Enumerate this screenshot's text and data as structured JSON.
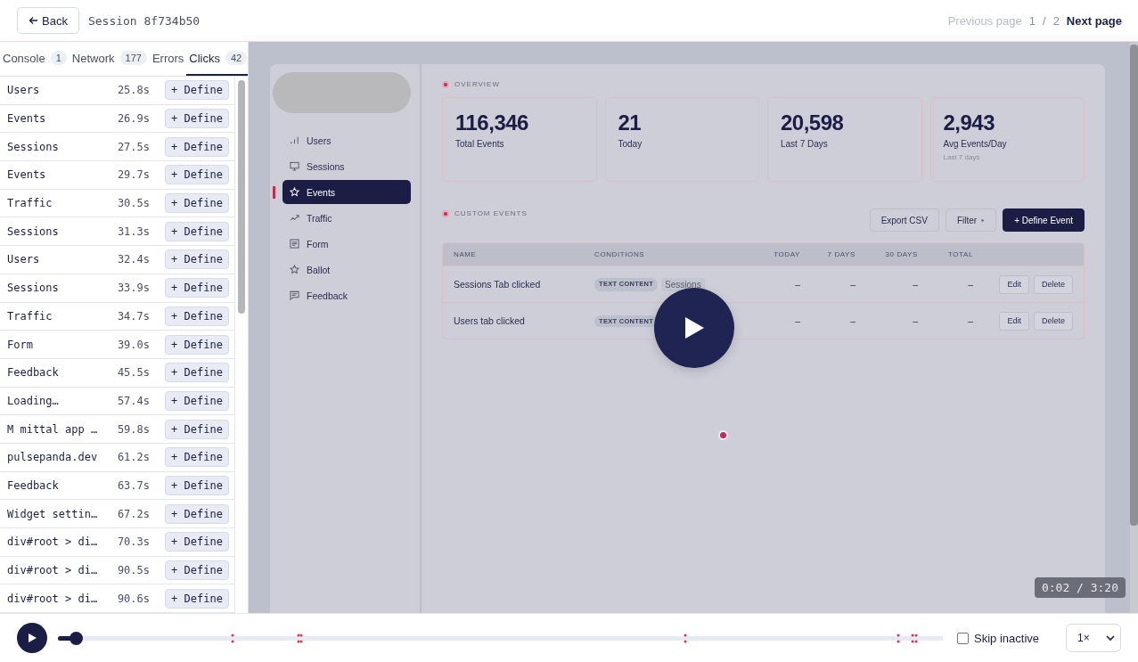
{
  "header": {
    "back_button": "Back",
    "session_title": "Session 8f734b50",
    "pagination": {
      "previous": {
        "label": "Previous page",
        "disabled": true
      },
      "current": "1",
      "separator": "/",
      "total": "2",
      "next": {
        "label": "Next page",
        "disabled": false
      }
    }
  },
  "tabs": [
    {
      "label": "Console",
      "count": "1",
      "selected": false
    },
    {
      "label": "Network",
      "count": "177",
      "selected": false
    },
    {
      "label": "Errors",
      "selected": false
    },
    {
      "label": "Clicks",
      "count": "42",
      "selected": true
    }
  ],
  "clicks": [
    {
      "label": "Users",
      "time": "25.8s",
      "action": "+ Define"
    },
    {
      "label": "Events",
      "time": "26.9s",
      "action": "+ Define"
    },
    {
      "label": "Sessions",
      "time": "27.5s",
      "action": "+ Define"
    },
    {
      "label": "Events",
      "time": "29.7s",
      "action": "+ Define"
    },
    {
      "label": "Traffic",
      "time": "30.5s",
      "action": "+ Define"
    },
    {
      "label": "Sessions",
      "time": "31.3s",
      "action": "+ Define"
    },
    {
      "label": "Users",
      "time": "32.4s",
      "action": "+ Define"
    },
    {
      "label": "Sessions",
      "time": "33.9s",
      "action": "+ Define"
    },
    {
      "label": "Traffic",
      "time": "34.7s",
      "action": "+ Define"
    },
    {
      "label": "Form",
      "time": "39.0s",
      "action": "+ Define"
    },
    {
      "label": "Feedback",
      "time": "45.5s",
      "action": "+ Define"
    },
    {
      "label": "Loading…",
      "time": "57.4s",
      "action": "+ Define"
    },
    {
      "label": "M mittal app …",
      "time": "59.8s",
      "action": "+ Define"
    },
    {
      "label": "pulsepanda.dev",
      "time": "61.2s",
      "action": "+ Define"
    },
    {
      "label": "Feedback",
      "time": "63.7s",
      "action": "+ Define"
    },
    {
      "label": "Widget settin…",
      "time": "67.2s",
      "action": "+ Define"
    },
    {
      "label": "div#root > di…",
      "time": "70.3s",
      "action": "+ Define"
    },
    {
      "label": "div#root > di…",
      "time": "90.5s",
      "action": "+ Define"
    },
    {
      "label": "div#root > di…",
      "time": "90.6s",
      "action": "+ Define"
    }
  ],
  "replay": {
    "app": {
      "nav": [
        {
          "label": "Users",
          "kind": "bars",
          "selected": false
        },
        {
          "label": "Sessions",
          "kind": "monitor",
          "selected": false
        },
        {
          "label": "Events",
          "kind": "star",
          "selected": true
        },
        {
          "label": "Traffic",
          "kind": "trend",
          "selected": false
        },
        {
          "label": "Form",
          "kind": "form",
          "selected": false
        },
        {
          "label": "Ballot",
          "kind": "star",
          "selected": false
        },
        {
          "label": "Feedback",
          "kind": "message",
          "selected": false
        }
      ],
      "overview_label": "OVERVIEW",
      "stats": [
        {
          "value": "116,346",
          "label": "Total Events"
        },
        {
          "value": "21",
          "label": "Today"
        },
        {
          "value": "20,598",
          "label": "Last 7 Days"
        },
        {
          "value": "2,943",
          "label": "Avg Events/Day",
          "note": "Last 7 days"
        }
      ],
      "custom_label": "CUSTOM EVENTS",
      "buttons": [
        {
          "label": "Export CSV",
          "kind": "outline"
        },
        {
          "label": "Filter",
          "kind": "dropdown"
        },
        {
          "label": "+ Define Event",
          "kind": "primary"
        }
      ],
      "table": {
        "columns": [
          "NAME",
          "CONDITIONS",
          "TODAY",
          "7 DAYS",
          "30 DAYS",
          "TOTAL"
        ],
        "rows": [
          {
            "name": "Sessions Tab clicked",
            "condition_tag": "TEXT CONTENT",
            "condition_value": "Sessions",
            "today": "–",
            "days7": "–",
            "days30": "–",
            "total": "–",
            "actions": [
              "Edit",
              "Delete"
            ]
          },
          {
            "name": "Users tab clicked",
            "condition_tag": "TEXT CONTENT",
            "today": "–",
            "days7": "–",
            "days30": "–",
            "total": "–",
            "actions": [
              "Edit",
              "Delete"
            ]
          }
        ]
      }
    },
    "time": "0:02 / 3:20"
  },
  "controls": {
    "playing": false,
    "level": 0.02,
    "skip_inactive": {
      "label": "Skip inactive",
      "checked": false
    },
    "speed": "1×"
  }
}
